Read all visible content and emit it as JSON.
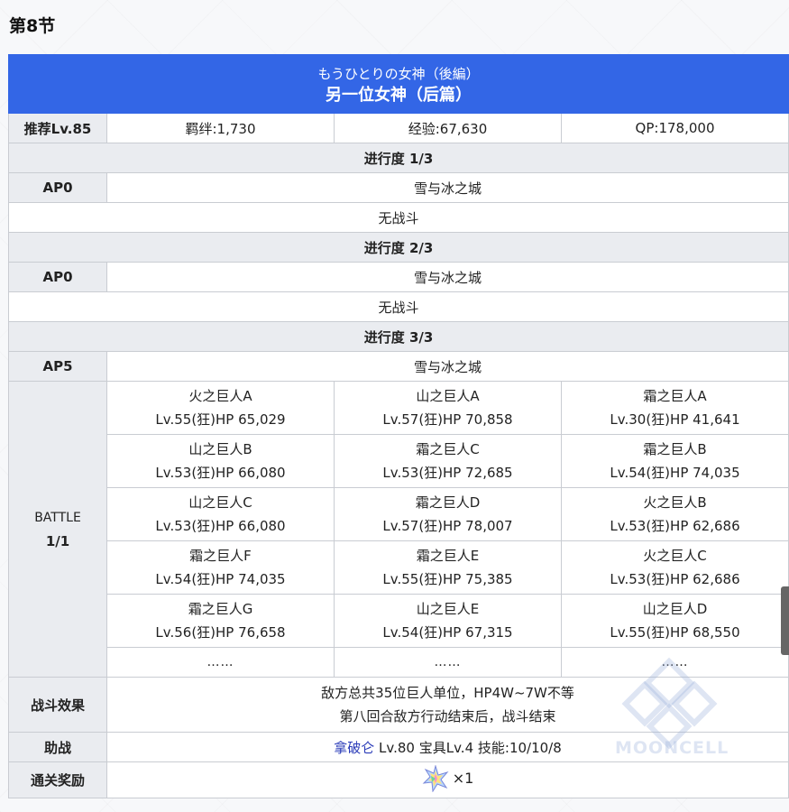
{
  "section": {
    "title": "第8节"
  },
  "quest": {
    "title_jp": "もうひとりの女神（後編）",
    "title_cn": "另一位女神（后篇）",
    "recommend_label": "推荐Lv.85",
    "bond": "羁绊:1,730",
    "exp": "经验:67,630",
    "qp": "QP:178,000"
  },
  "progress": [
    {
      "band": "进行度 1/3",
      "ap": "AP0",
      "location": "雪与冰之城",
      "note": "无战斗"
    },
    {
      "band": "进行度 2/3",
      "ap": "AP0",
      "location": "雪与冰之城",
      "note": "无战斗"
    },
    {
      "band": "进行度 3/3",
      "ap": "AP5",
      "location": "雪与冰之城"
    }
  ],
  "battle": {
    "label_line1": "BATTLE",
    "label_line2": "1/1",
    "rows": [
      [
        {
          "name": "火之巨人A",
          "stats": "Lv.55(狂)HP 65,029"
        },
        {
          "name": "山之巨人A",
          "stats": "Lv.57(狂)HP 70,858"
        },
        {
          "name": "霜之巨人A",
          "stats": "Lv.30(狂)HP 41,641"
        }
      ],
      [
        {
          "name": "山之巨人B",
          "stats": "Lv.53(狂)HP 66,080"
        },
        {
          "name": "霜之巨人C",
          "stats": "Lv.53(狂)HP 72,685"
        },
        {
          "name": "霜之巨人B",
          "stats": "Lv.54(狂)HP 74,035"
        }
      ],
      [
        {
          "name": "山之巨人C",
          "stats": "Lv.53(狂)HP 66,080"
        },
        {
          "name": "霜之巨人D",
          "stats": "Lv.57(狂)HP 78,007"
        },
        {
          "name": "火之巨人B",
          "stats": "Lv.53(狂)HP 62,686"
        }
      ],
      [
        {
          "name": "霜之巨人F",
          "stats": "Lv.54(狂)HP 74,035"
        },
        {
          "name": "霜之巨人E",
          "stats": "Lv.55(狂)HP 75,385"
        },
        {
          "name": "火之巨人C",
          "stats": "Lv.53(狂)HP 62,686"
        }
      ],
      [
        {
          "name": "霜之巨人G",
          "stats": "Lv.56(狂)HP 76,658"
        },
        {
          "name": "山之巨人E",
          "stats": "Lv.54(狂)HP 67,315"
        },
        {
          "name": "山之巨人D",
          "stats": "Lv.55(狂)HP 68,550"
        }
      ]
    ],
    "ellipsis": [
      "……",
      "……",
      "……"
    ]
  },
  "effect": {
    "label": "战斗效果",
    "line1": "敌方总共35位巨人单位，HP4W~7W不等",
    "line2": "第八回合敌方行动结束后，战斗结束"
  },
  "support": {
    "label": "助战",
    "name": "拿破仑",
    "details": " Lv.80 宝具Lv.4 技能:10/10/8"
  },
  "reward": {
    "label": "通关奖励",
    "icon": "saint-quartz-icon",
    "quantity": "×1"
  },
  "watermark": {
    "text": "MOONCELL"
  },
  "colors": {
    "header_blue": "#3366e6",
    "label_gray": "#eaecf0",
    "link_blue": "#2a3bb8"
  }
}
